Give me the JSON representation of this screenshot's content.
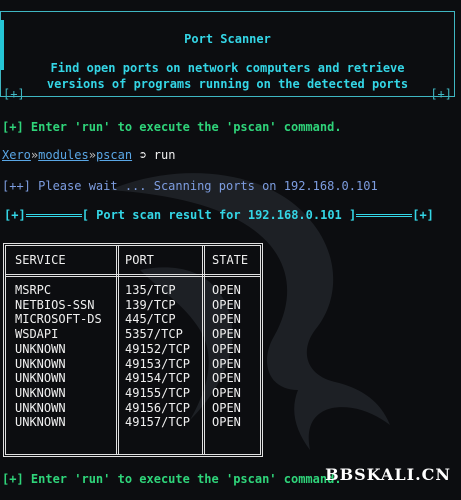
{
  "banner": {
    "title": "Port Scanner",
    "desc_line1": "Find open ports on network computers and retrieve",
    "desc_line2": "versions of programs running on the detected ports",
    "corner_left": "[+]",
    "corner_right": "[+]"
  },
  "instruction_top": "[+] Enter 'run' to execute the 'pscan' command.",
  "prompt": {
    "user": "Xero",
    "sep1": "»",
    "dir1": "modules",
    "sep2": "»",
    "dir2": "pscan",
    "arrow": " ➲ ",
    "command": "run"
  },
  "please_wait": "[++] Please wait ... Scanning ports on 192.168.0.101",
  "result_bar": {
    "left": "[+]",
    "text": "[ Port scan result for 192.168.0.101 ]",
    "right": "[+]"
  },
  "table": {
    "headers": [
      "SERVICE",
      "PORT",
      "STATE"
    ],
    "rows": [
      {
        "service": "MSRPC",
        "port": "135/TCP",
        "state": "OPEN"
      },
      {
        "service": "NETBIOS-SSN",
        "port": "139/TCP",
        "state": "OPEN"
      },
      {
        "service": "MICROSOFT-DS",
        "port": "445/TCP",
        "state": "OPEN"
      },
      {
        "service": "WSDAPI",
        "port": "5357/TCP",
        "state": "OPEN"
      },
      {
        "service": "UNKNOWN",
        "port": "49152/TCP",
        "state": "OPEN"
      },
      {
        "service": "UNKNOWN",
        "port": "49153/TCP",
        "state": "OPEN"
      },
      {
        "service": "UNKNOWN",
        "port": "49154/TCP",
        "state": "OPEN"
      },
      {
        "service": "UNKNOWN",
        "port": "49155/TCP",
        "state": "OPEN"
      },
      {
        "service": "UNKNOWN",
        "port": "49156/TCP",
        "state": "OPEN"
      },
      {
        "service": "UNKNOWN",
        "port": "49157/TCP",
        "state": "OPEN"
      }
    ]
  },
  "instruction_bottom": "[+] Enter 'run' to execute the 'pscan' command.",
  "watermark": "BBSKALI.CN",
  "colors": {
    "background": "#0c0d10",
    "accent_cyan": "#34d6e6",
    "accent_green": "#2fd47a",
    "info_blue": "#7d9de0"
  }
}
